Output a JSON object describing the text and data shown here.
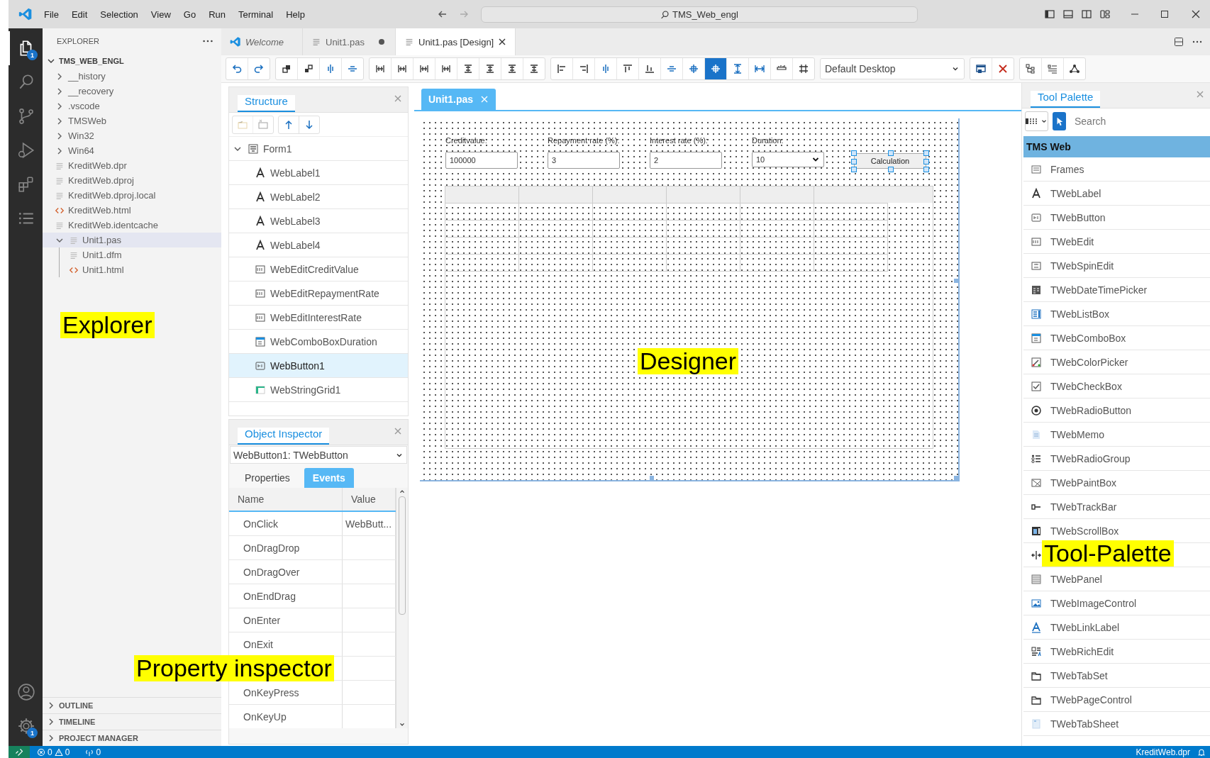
{
  "window": {
    "title": "TMS_Web_engl"
  },
  "menu": [
    {
      "label": "File"
    },
    {
      "label": "Edit"
    },
    {
      "label": "Selection"
    },
    {
      "label": "View"
    },
    {
      "label": "Go"
    },
    {
      "label": "Run"
    },
    {
      "label": "Terminal"
    },
    {
      "label": "Help"
    }
  ],
  "activity_bar": {
    "items": [
      {
        "kind": "files",
        "selected": true,
        "badge": "1"
      },
      {
        "kind": "search",
        "selected": false
      },
      {
        "kind": "source-control",
        "selected": false
      },
      {
        "kind": "run",
        "selected": false
      },
      {
        "kind": "extensions",
        "selected": false
      },
      {
        "kind": "list",
        "selected": false
      }
    ],
    "bottom": [
      {
        "kind": "account"
      },
      {
        "kind": "settings",
        "badge": "1"
      }
    ]
  },
  "explorer": {
    "title": "EXPLORER",
    "root": "TMS_WEB_ENGL",
    "tree": [
      {
        "label": "__history",
        "kind": "folder",
        "expanded": false,
        "selected": false
      },
      {
        "label": "__recovery",
        "kind": "folder",
        "expanded": false,
        "selected": false
      },
      {
        "label": ".vscode",
        "kind": "folder",
        "expanded": false,
        "selected": false
      },
      {
        "label": "TMSWeb",
        "kind": "folder",
        "expanded": false,
        "selected": false
      },
      {
        "label": "Win32",
        "kind": "folder",
        "expanded": false,
        "selected": false
      },
      {
        "label": "Win64",
        "kind": "folder",
        "expanded": false,
        "selected": false
      },
      {
        "label": "KreditWeb.dpr",
        "kind": "file",
        "selected": false
      },
      {
        "label": "KreditWeb.dproj",
        "kind": "file",
        "selected": false
      },
      {
        "label": "KreditWeb.dproj.local",
        "kind": "file",
        "selected": false
      },
      {
        "label": "KreditWeb.html",
        "kind": "html",
        "selected": false
      },
      {
        "label": "KreditWeb.identcache",
        "kind": "file",
        "selected": false
      },
      {
        "label": "Unit1.pas",
        "kind": "file",
        "expanded": true,
        "selected": true,
        "children": [
          {
            "label": "Unit1.dfm",
            "kind": "file",
            "selected": false
          },
          {
            "label": "Unit1.html",
            "kind": "html",
            "selected": false
          }
        ]
      }
    ],
    "sections": [
      {
        "label": "OUTLINE",
        "expanded": false
      },
      {
        "label": "TIMELINE",
        "expanded": false
      },
      {
        "label": "PROJECT MANAGER",
        "expanded": false
      }
    ]
  },
  "editor_tabs": [
    {
      "label": "Welcome",
      "kind": "welcome",
      "selected": false,
      "modified": false
    },
    {
      "label": "Unit1.pas",
      "kind": "file",
      "selected": false,
      "modified": true
    },
    {
      "label": "Unit1.pas [Design]",
      "kind": "file",
      "selected": true,
      "modified": false
    }
  ],
  "toolbar": {
    "groups": [
      [
        {
          "kind": "undo",
          "selected": false
        },
        {
          "kind": "redo",
          "selected": false
        }
      ],
      [
        {
          "kind": "bring-front",
          "selected": false
        },
        {
          "kind": "send-back",
          "selected": false
        },
        {
          "kind": "center-h",
          "selected": false
        },
        {
          "kind": "center-v",
          "selected": false
        }
      ],
      [
        {
          "kind": "space-h",
          "selected": false
        },
        {
          "kind": "space-h",
          "selected": false
        },
        {
          "kind": "space-h",
          "selected": false
        },
        {
          "kind": "space-h",
          "selected": false
        },
        {
          "kind": "space-v",
          "selected": false
        },
        {
          "kind": "space-v",
          "selected": false
        },
        {
          "kind": "space-v",
          "selected": false
        },
        {
          "kind": "space-v",
          "selected": false
        }
      ],
      [
        {
          "kind": "align-left",
          "selected": false
        },
        {
          "kind": "align-right",
          "selected": false
        },
        {
          "kind": "center-h",
          "selected": false
        },
        {
          "kind": "align-top",
          "selected": false
        },
        {
          "kind": "align-bottom",
          "selected": false
        },
        {
          "kind": "center-v",
          "selected": false
        },
        {
          "kind": "center-window",
          "selected": false
        },
        {
          "kind": "center-window",
          "selected": true
        },
        {
          "kind": "same-height",
          "selected": false
        },
        {
          "kind": "same-width",
          "selected": false
        },
        {
          "kind": "size-grid",
          "selected": false
        },
        {
          "kind": "grid",
          "selected": false
        }
      ]
    ],
    "layout": {
      "value": "Default Desktop"
    },
    "groups_after": [
      [
        {
          "kind": "form",
          "selected": false
        },
        {
          "kind": "delete",
          "selected": false
        }
      ],
      [
        {
          "kind": "hierarchy",
          "selected": false
        },
        {
          "kind": "list",
          "selected": false
        },
        {
          "kind": "graph",
          "selected": false
        }
      ]
    ]
  },
  "structure": {
    "title": "Structure",
    "tools": [
      {
        "kind": "new",
        "disabled": true
      },
      {
        "kind": "remove",
        "disabled": true
      },
      {
        "kind": "up",
        "disabled": false
      },
      {
        "kind": "down",
        "disabled": false
      }
    ],
    "tree": [
      {
        "label": "Form1",
        "kind": "form",
        "expanded": true,
        "selected": false,
        "children": [
          {
            "label": "WebLabel1",
            "kind": "label",
            "selected": false
          },
          {
            "label": "WebLabel2",
            "kind": "label",
            "selected": false
          },
          {
            "label": "WebLabel3",
            "kind": "label",
            "selected": false
          },
          {
            "label": "WebLabel4",
            "kind": "label",
            "selected": false
          },
          {
            "label": "WebEditCreditValue",
            "kind": "edit",
            "selected": false
          },
          {
            "label": "WebEditRepaymentRate",
            "kind": "edit",
            "selected": false
          },
          {
            "label": "WebEditInterestRate",
            "kind": "edit",
            "selected": false
          },
          {
            "label": "WebComboBoxDuration",
            "kind": "combobox",
            "selected": false
          },
          {
            "label": "WebButton1",
            "kind": "button",
            "selected": true
          },
          {
            "label": "WebStringGrid1",
            "kind": "grid",
            "selected": false
          }
        ]
      }
    ]
  },
  "inspector": {
    "title": "Object Inspector",
    "object": "WebButton1: TWebButton",
    "tabs": [
      {
        "label": "Properties",
        "selected": false
      },
      {
        "label": "Events",
        "selected": true
      }
    ],
    "columns": [
      "Name",
      "Value"
    ],
    "rows": [
      {
        "kind": "row",
        "name": "OnClick",
        "value": "WebButt..."
      },
      {
        "kind": "row",
        "name": "OnDragDrop"
      },
      {
        "kind": "row",
        "name": "OnDragOver"
      },
      {
        "kind": "row",
        "name": "OnEndDrag"
      },
      {
        "kind": "row",
        "name": "OnEnter"
      },
      {
        "kind": "row",
        "name": "OnExit"
      },
      {
        "kind": "blank"
      },
      {
        "kind": "row",
        "name": "OnKeyPress"
      },
      {
        "kind": "row",
        "name": "OnKeyUp"
      }
    ]
  },
  "designer": {
    "tab": {
      "label": "Unit1.pas",
      "selected": true
    },
    "controls": [
      {
        "kind": "edit",
        "label": "Creditvalue:",
        "value": "100000"
      },
      {
        "kind": "edit",
        "label": "Repayment rate (%):",
        "value": "3"
      },
      {
        "kind": "edit",
        "label": "Interest rate (%):",
        "value": "2"
      },
      {
        "kind": "combo",
        "label": "Duration:",
        "value": "10"
      },
      {
        "kind": "button",
        "label": "Calculation",
        "selected": true
      }
    ]
  },
  "palette": {
    "title": "Tool Palette",
    "search": {
      "placeholder": "Search"
    },
    "category": {
      "label": "TMS Web",
      "expanded": true
    },
    "items": [
      {
        "kind": "frames",
        "label": "Frames"
      },
      {
        "kind": "label",
        "label": "TWebLabel"
      },
      {
        "kind": "button",
        "label": "TWebButton"
      },
      {
        "kind": "edit",
        "label": "TWebEdit"
      },
      {
        "kind": "spinedit",
        "label": "TWebSpinEdit"
      },
      {
        "kind": "datetime",
        "label": "TWebDateTimePicker"
      },
      {
        "kind": "listbox",
        "label": "TWebListBox"
      },
      {
        "kind": "combobox",
        "label": "TWebComboBox"
      },
      {
        "kind": "colorpicker",
        "label": "TWebColorPicker"
      },
      {
        "kind": "checkbox",
        "label": "TWebCheckBox"
      },
      {
        "kind": "radiobutton",
        "label": "TWebRadioButton"
      },
      {
        "kind": "memo",
        "label": "TWebMemo"
      },
      {
        "kind": "radiogroup",
        "label": "TWebRadioGroup"
      },
      {
        "kind": "paintbox",
        "label": "TWebPaintBox"
      },
      {
        "kind": "trackbar",
        "label": "TWebTrackBar"
      },
      {
        "kind": "scrollbox",
        "label": "TWebScrollBox"
      },
      {
        "kind": "splitter"
      },
      {
        "kind": "panel",
        "label": "TWebPanel"
      },
      {
        "kind": "image",
        "label": "TWebImageControl"
      },
      {
        "kind": "linklabel",
        "label": "TWebLinkLabel"
      },
      {
        "kind": "richedit",
        "label": "TWebRichEdit"
      },
      {
        "kind": "tabset",
        "label": "TWebTabSet"
      },
      {
        "kind": "pagecontrol",
        "label": "TWebPageControl"
      },
      {
        "kind": "tabsheet",
        "label": "TWebTabSheet"
      }
    ]
  },
  "status_bar": {
    "errors": "0",
    "warnings": "0",
    "ports": "0",
    "file": "KreditWeb.dpr"
  },
  "annotations": [
    {
      "label": "Explorer"
    },
    {
      "label": "Designer"
    },
    {
      "label": "Tool-Palette"
    },
    {
      "label": "Property inspector"
    }
  ]
}
